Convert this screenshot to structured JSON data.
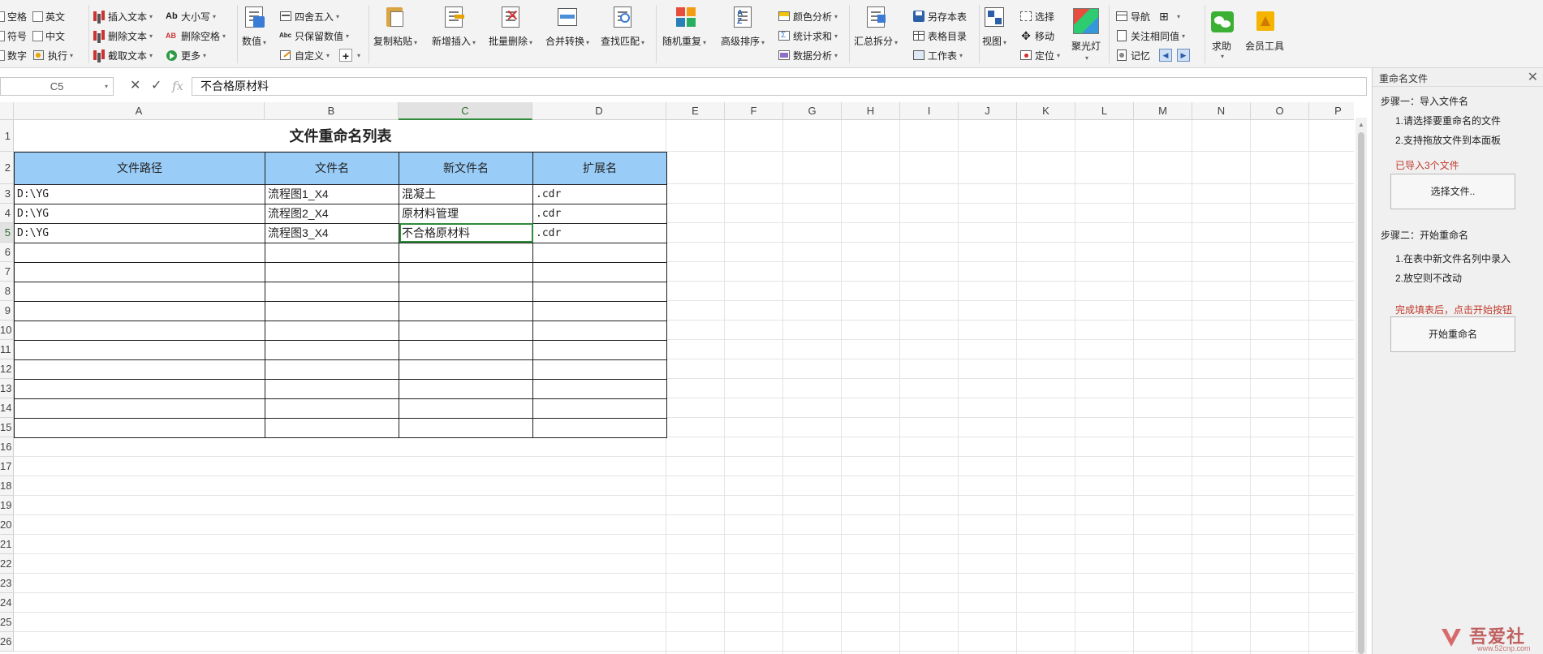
{
  "ribbon": {
    "group1": {
      "items": [
        "空格",
        "英文",
        "符号",
        "中文",
        "数字",
        "执行"
      ]
    },
    "group2": {
      "items": [
        "插入文本",
        "大小写",
        "删除文本",
        "删除空格",
        "截取文本",
        "更多"
      ]
    },
    "group3": {
      "big": "数值",
      "items": [
        "四舍五入",
        "只保留数值",
        "自定义"
      ]
    },
    "group4": {
      "buttons": [
        "复制粘贴",
        "新增插入",
        "批量删除",
        "合并转换",
        "查找匹配"
      ]
    },
    "group5": {
      "buttons": [
        "随机重复",
        "高级排序"
      ],
      "items": [
        "颜色分析",
        "统计求和",
        "数据分析"
      ]
    },
    "group6": {
      "big": "汇总拆分",
      "items": [
        "另存本表",
        "表格目录",
        "工作表"
      ]
    },
    "group7": {
      "big": "视图",
      "items": [
        "选择",
        "移动",
        "定位"
      ],
      "big2": "聚光灯"
    },
    "group8": {
      "items": [
        "导航",
        "关注相同值",
        "记忆"
      ]
    },
    "group9": {
      "buttons": [
        "求助",
        "会员工具"
      ]
    }
  },
  "formula_bar": {
    "name_box": "C5",
    "cancel": "✕",
    "confirm": "✓",
    "fx": "fx",
    "value": "不合格原材料"
  },
  "sheet": {
    "columns": [
      "A",
      "B",
      "C",
      "D",
      "E",
      "F",
      "G",
      "H",
      "I",
      "J",
      "K",
      "L",
      "M",
      "N",
      "O",
      "P"
    ],
    "rows": [
      "1",
      "2",
      "3",
      "4",
      "5",
      "6",
      "7",
      "8",
      "9",
      "10",
      "11",
      "12",
      "13",
      "14",
      "15",
      "16",
      "17",
      "18",
      "19",
      "20",
      "21",
      "22",
      "23",
      "24",
      "25",
      "26"
    ],
    "active_cell": "C5",
    "title": "文件重命名列表",
    "headers": [
      "文件路径",
      "文件名",
      "新文件名",
      "扩展名"
    ],
    "data": [
      [
        "D:\\YG",
        "流程图1_X4",
        "混凝土",
        ".cdr"
      ],
      [
        "D:\\YG",
        "流程图2_X4",
        "原材料管理",
        ".cdr"
      ],
      [
        "D:\\YG",
        "流程图3_X4",
        "不合格原材料",
        ".cdr"
      ]
    ]
  },
  "panel": {
    "title": "重命名文件",
    "close": "✕",
    "step1_title": "步骤一：导入文件名",
    "step1_line1": "1.请选择要重命名的文件",
    "step1_line2": "2.支持拖放文件到本面板",
    "imported_status": "已导入3个文件",
    "choose_files_button": "选择文件..",
    "step2_title": "步骤二：开始重命名",
    "step2_line1": "1.在表中新文件名列中录入",
    "step2_line2": "2.放空则不改动",
    "complete_hint": "完成填表后，点击开始按钮",
    "start_button": "开始重命名"
  },
  "watermark": {
    "text": "吾爱社区",
    "url": "www.52cnp.com"
  },
  "colors": {
    "header_fill": "#99ccf7",
    "active_cell_border": "#2e8b3a",
    "panel_red": "#c0392b"
  }
}
